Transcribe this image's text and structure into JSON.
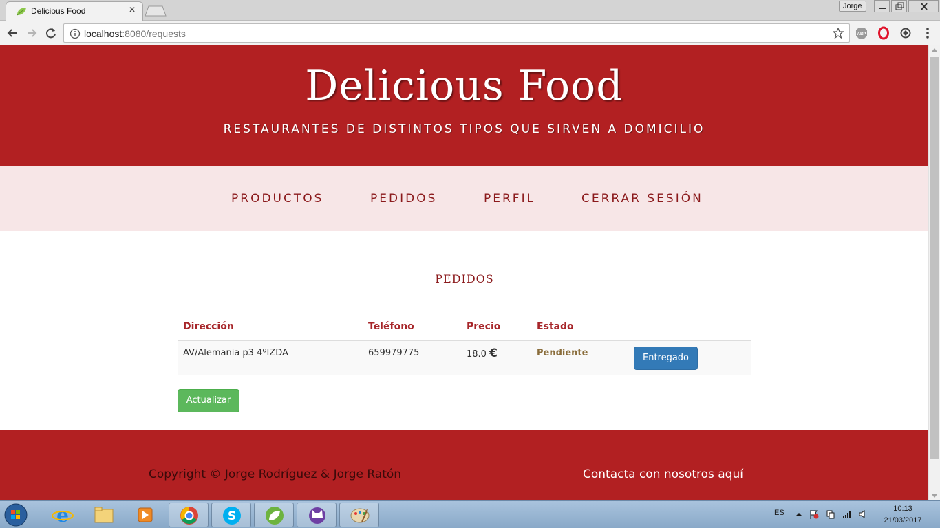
{
  "browser": {
    "tab_title": "Delicious Food",
    "tab_close": "×",
    "profile_name": "Jorge",
    "url_host": "localhost",
    "url_rest": ":8080/requests"
  },
  "site": {
    "title": "Delicious Food",
    "tagline": "RESTAURANTES DE DISTINTOS TIPOS QUE SIRVEN A DOMICILIO",
    "accent_color": "#b22022",
    "nav_bg_color": "#f7e6e7"
  },
  "nav": {
    "items": [
      {
        "label": "PRODUCTOS"
      },
      {
        "label": "PEDIDOS"
      },
      {
        "label": "PERFIL"
      },
      {
        "label": "CERRAR SESIÓN"
      }
    ]
  },
  "main": {
    "section_title": "PEDIDOS",
    "table": {
      "headers": [
        "Dirección",
        "Teléfono",
        "Precio",
        "Estado"
      ],
      "rows": [
        {
          "direccion": "AV/Alemania p3 4ºIZDA",
          "telefono": "659979775",
          "precio": "18.0",
          "currency": "€",
          "estado": "Pendiente",
          "action_label": "Entregado"
        }
      ]
    },
    "refresh_label": "Actualizar"
  },
  "footer": {
    "copyright": "Copyright © Jorge Rodríguez & Jorge Ratón",
    "contact": "Contacta con nosotros aquí"
  },
  "taskbar": {
    "language": "ES",
    "time": "10:13",
    "date": "21/03/2017",
    "pinned_apps": [
      "internet-explorer",
      "windows-explorer",
      "media-player",
      "chrome",
      "skype",
      "spring-tool-suite",
      "github-octocat",
      "paint"
    ]
  }
}
